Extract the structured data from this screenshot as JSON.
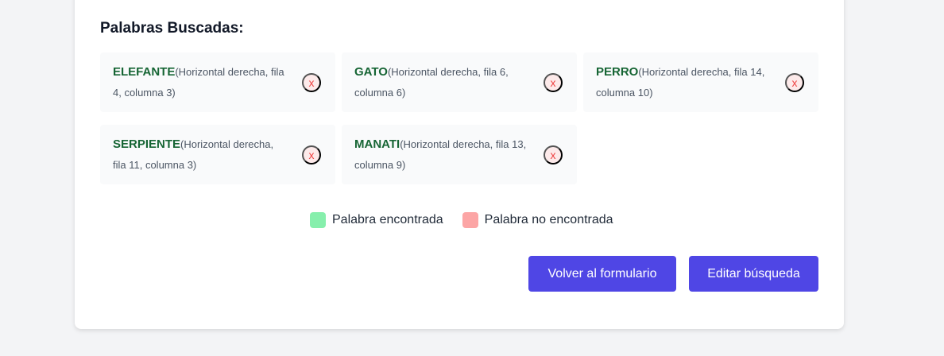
{
  "section": {
    "title": "Palabras Buscadas:"
  },
  "words": [
    {
      "name": "ELEFANTE",
      "detail": "(Horizontal derecha, fila 4, columna 3)",
      "remove_label": "x"
    },
    {
      "name": "GATO",
      "detail": "(Horizontal derecha, fila 6, columna 6)",
      "remove_label": "x"
    },
    {
      "name": "PERRO",
      "detail": "(Horizontal derecha, fila 14, columna 10)",
      "remove_label": "x"
    },
    {
      "name": "SERPIENTE",
      "detail": "(Horizontal derecha, fila 11, columna 3)",
      "remove_label": "x"
    },
    {
      "name": "MANATI",
      "detail": "(Horizontal derecha, fila 13, columna 9)",
      "remove_label": "x"
    }
  ],
  "legend": {
    "found_label": "Palabra encontrada",
    "found_color": "#86efac",
    "not_found_label": "Palabra no encontrada",
    "not_found_color": "#fca5a5"
  },
  "actions": {
    "back_label": "Volver al formulario",
    "edit_label": "Editar búsqueda"
  }
}
